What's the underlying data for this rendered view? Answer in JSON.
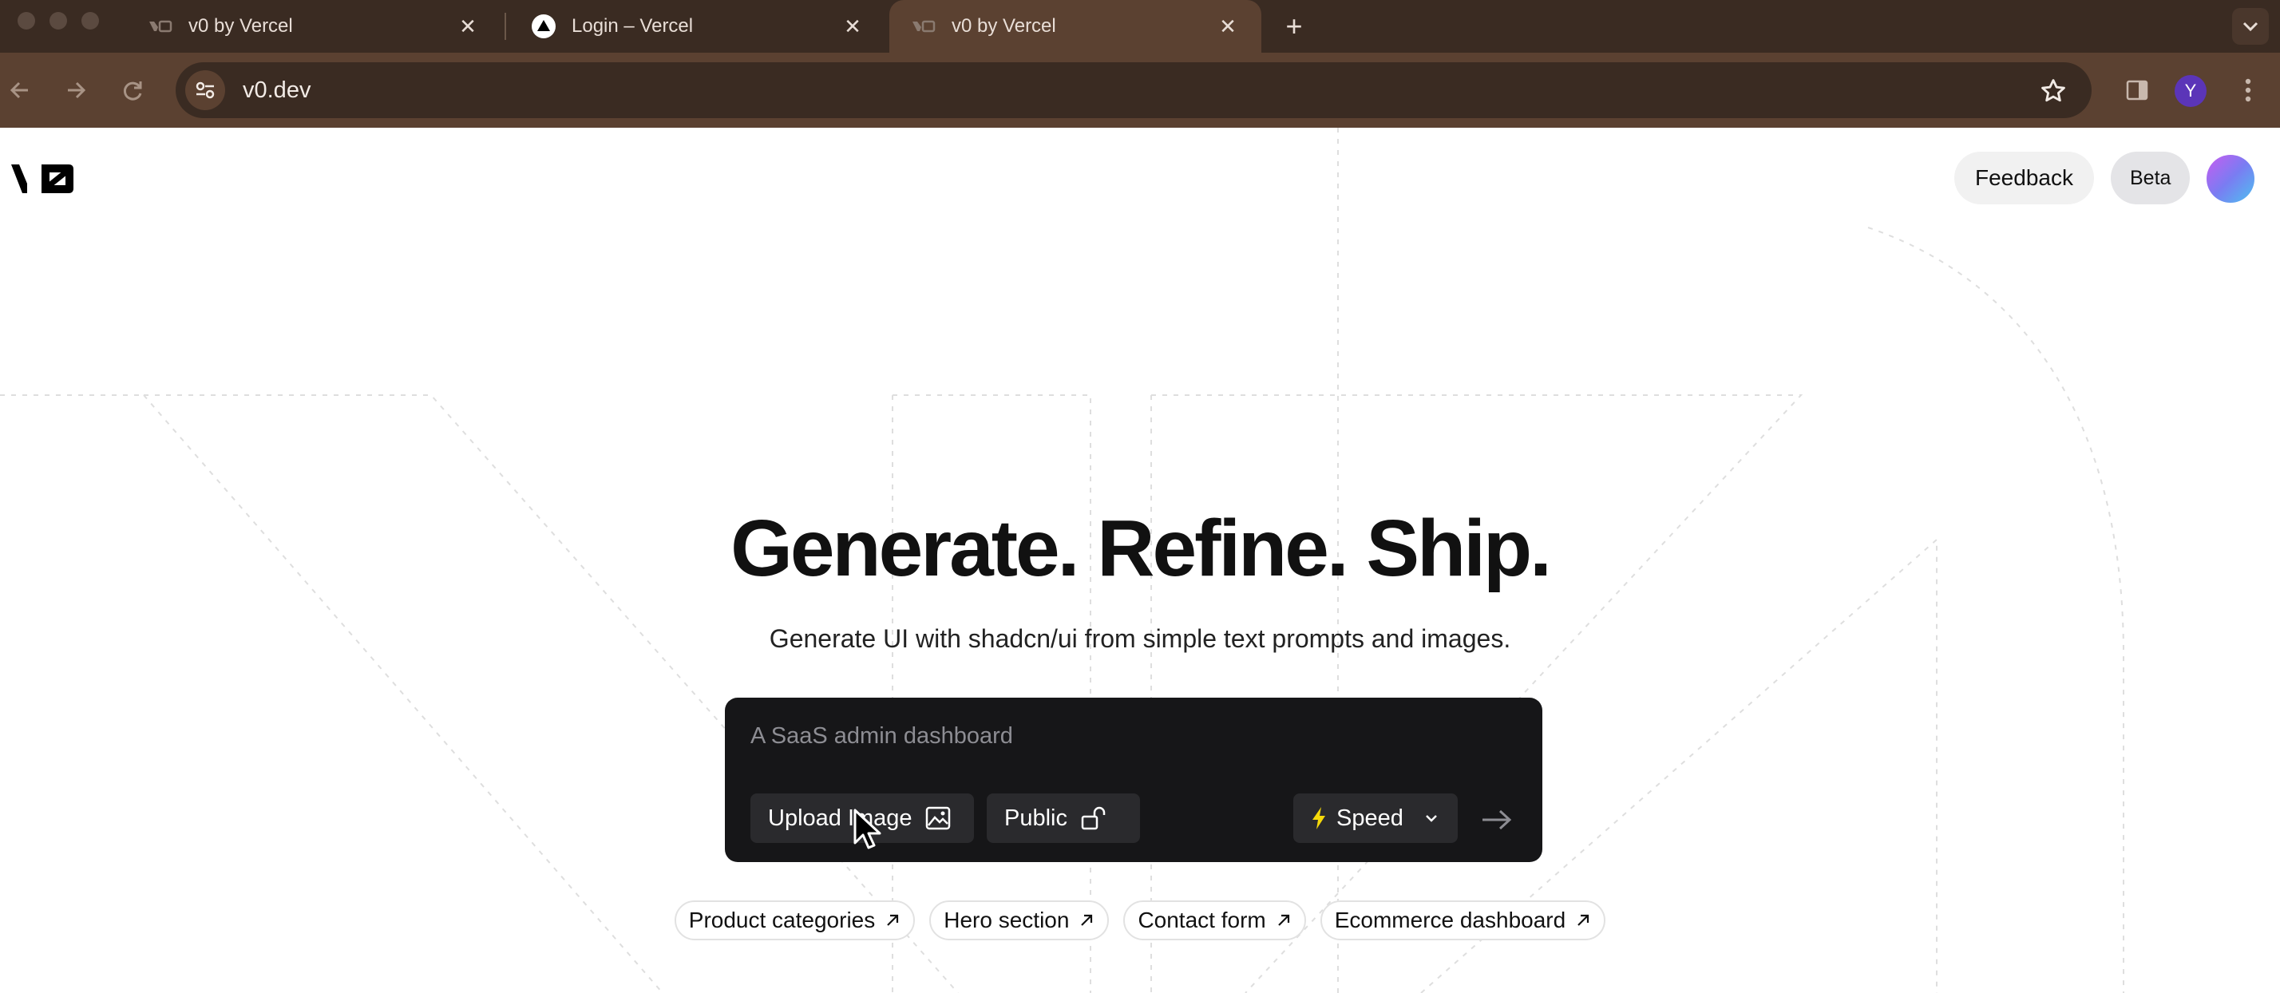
{
  "browser": {
    "tabs": [
      {
        "title": "v0 by Vercel",
        "active": false,
        "favicon": "v0-logo-icon"
      },
      {
        "title": "Login – Vercel",
        "active": false,
        "favicon": "vercel-triangle-icon"
      },
      {
        "title": "v0 by Vercel",
        "active": true,
        "favicon": "v0-logo-icon"
      }
    ],
    "url": "v0.dev",
    "profile_initial": "Y"
  },
  "header": {
    "feedback_label": "Feedback",
    "beta_label": "Beta"
  },
  "hero": {
    "headline": "Generate. Refine. Ship.",
    "subheadline": "Generate UI with shadcn/ui from simple text prompts and images."
  },
  "prompt": {
    "placeholder": "A SaaS admin dashboard",
    "upload_label": "Upload Image",
    "visibility_label": "Public",
    "mode_label": "Speed"
  },
  "suggestions": [
    {
      "label": "Product categories"
    },
    {
      "label": "Hero section"
    },
    {
      "label": "Contact form"
    },
    {
      "label": "Ecommerce dashboard"
    }
  ],
  "colors": {
    "tabbar": "#3a2b22",
    "toolbar": "#5b4131",
    "prompt_bg": "#161618",
    "speed_bolt": "#f5d90a",
    "profile": "#5b35b8"
  }
}
